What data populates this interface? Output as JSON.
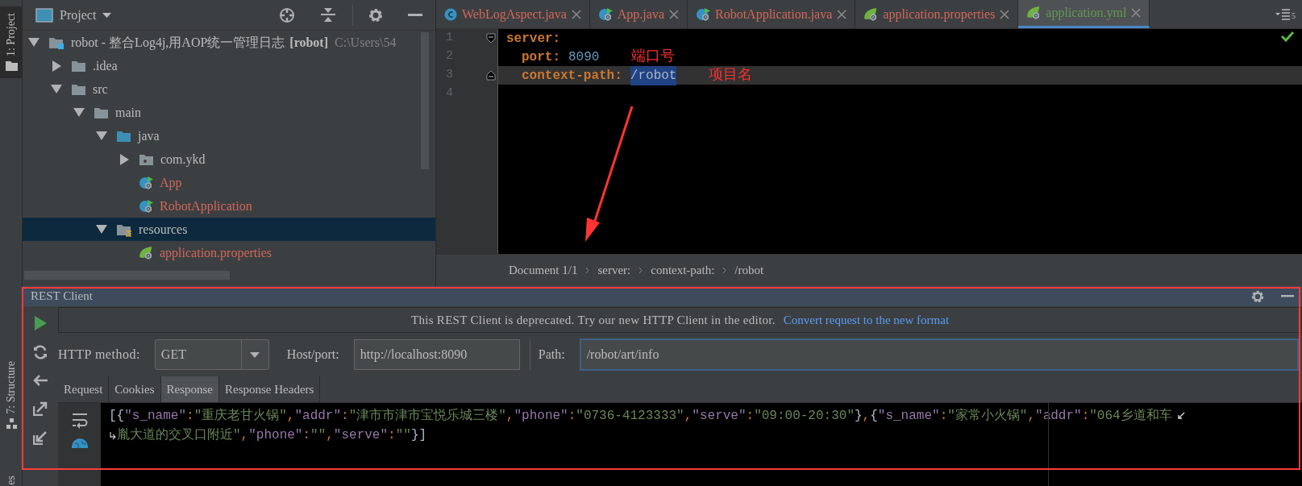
{
  "tool_strip": [
    {
      "label": "1: Project",
      "selected": true
    },
    {
      "label": "7: Structure",
      "selected": false
    },
    {
      "label": "es",
      "selected": false
    }
  ],
  "project_panel": {
    "title": "Project",
    "tree": [
      {
        "label": "robot - 整合Log4j,用AOP统一管理日志",
        "module": "[robot]",
        "path": "C:\\Users\\54",
        "kind": "module",
        "expanded": true,
        "selected": false,
        "children": [
          {
            "label": ".idea",
            "kind": "folder",
            "expanded": false,
            "selected": false
          },
          {
            "label": "src",
            "kind": "folder",
            "expanded": true,
            "selected": false,
            "children": [
              {
                "label": "main",
                "kind": "folder",
                "expanded": true,
                "selected": false,
                "children": [
                  {
                    "label": "java",
                    "kind": "source",
                    "expanded": true,
                    "selected": false,
                    "children": [
                      {
                        "label": "com.ykd",
                        "kind": "package",
                        "expanded": false,
                        "selected": false
                      },
                      {
                        "label": "App",
                        "kind": "boot",
                        "selected": false,
                        "color": "#d1675a"
                      },
                      {
                        "label": "RobotApplication",
                        "kind": "boot",
                        "selected": false,
                        "color": "#d1675a"
                      }
                    ]
                  },
                  {
                    "label": "resources",
                    "kind": "resources",
                    "expanded": true,
                    "selected": true,
                    "children": [
                      {
                        "label": "application.properties",
                        "kind": "spring",
                        "selected": false,
                        "color": "#d1675a"
                      }
                    ]
                  }
                ]
              }
            ]
          }
        ]
      }
    ]
  },
  "editor": {
    "tabs": [
      {
        "label": "WebLogAspect.java",
        "kind": "class",
        "color": "#d1675a",
        "selected": false
      },
      {
        "label": "App.java",
        "kind": "boot",
        "color": "#d1675a",
        "selected": false
      },
      {
        "label": "RobotApplication.java",
        "kind": "boot",
        "color": "#d1675a",
        "selected": false
      },
      {
        "label": "application.properties",
        "kind": "spring",
        "color": "#d1675a",
        "selected": false
      },
      {
        "label": "application.yml",
        "kind": "spring",
        "color": "#629755",
        "selected": true
      }
    ],
    "tab_count": "5",
    "yaml": [
      {
        "line": "1",
        "key": "server:",
        "foldable": true,
        "children": [
          {
            "line": "2",
            "key": "port:",
            "value": "8090",
            "kind": "number",
            "foldable": false,
            "note": "端口号"
          },
          {
            "line": "3",
            "key": "context-path:",
            "value": "/robot",
            "kind": "string",
            "value_selected": true,
            "current": true,
            "foldable": true,
            "note": "项目名"
          }
        ]
      }
    ],
    "empty_lines": [
      "4"
    ],
    "breadcrumbs": [
      "Document 1/1",
      "server:",
      "context-path:",
      "/robot"
    ]
  },
  "rest_client": {
    "title": "REST Client",
    "notice": "This REST Client is deprecated. Try our new HTTP Client in the editor.",
    "notice_link": "Convert request to the new format",
    "method_label": "HTTP method:",
    "method": "GET",
    "host_label": "Host/port:",
    "host": "http://localhost:8090",
    "path_label": "Path:",
    "path": "/robot/art/info",
    "tabs": [
      {
        "label": "Request",
        "selected": false
      },
      {
        "label": "Cookies",
        "selected": false
      },
      {
        "label": "Response",
        "selected": true
      },
      {
        "label": "Response Headers",
        "selected": false
      }
    ],
    "response_lines": [
      "[{\"s_name\":\"重庆老甘火锅\",\"addr\":\"津市市津市宝悦乐城三楼\",\"phone\":\"0736-4123333\",\"serve\":\"09:00-20:30\"},{\"s_name\":\"家常小火锅\",\"addr\":\"064乡道和车",
      "胤大道的交叉口附近\",\"phone\":\"\",\"serve\":\"\"}]"
    ]
  }
}
